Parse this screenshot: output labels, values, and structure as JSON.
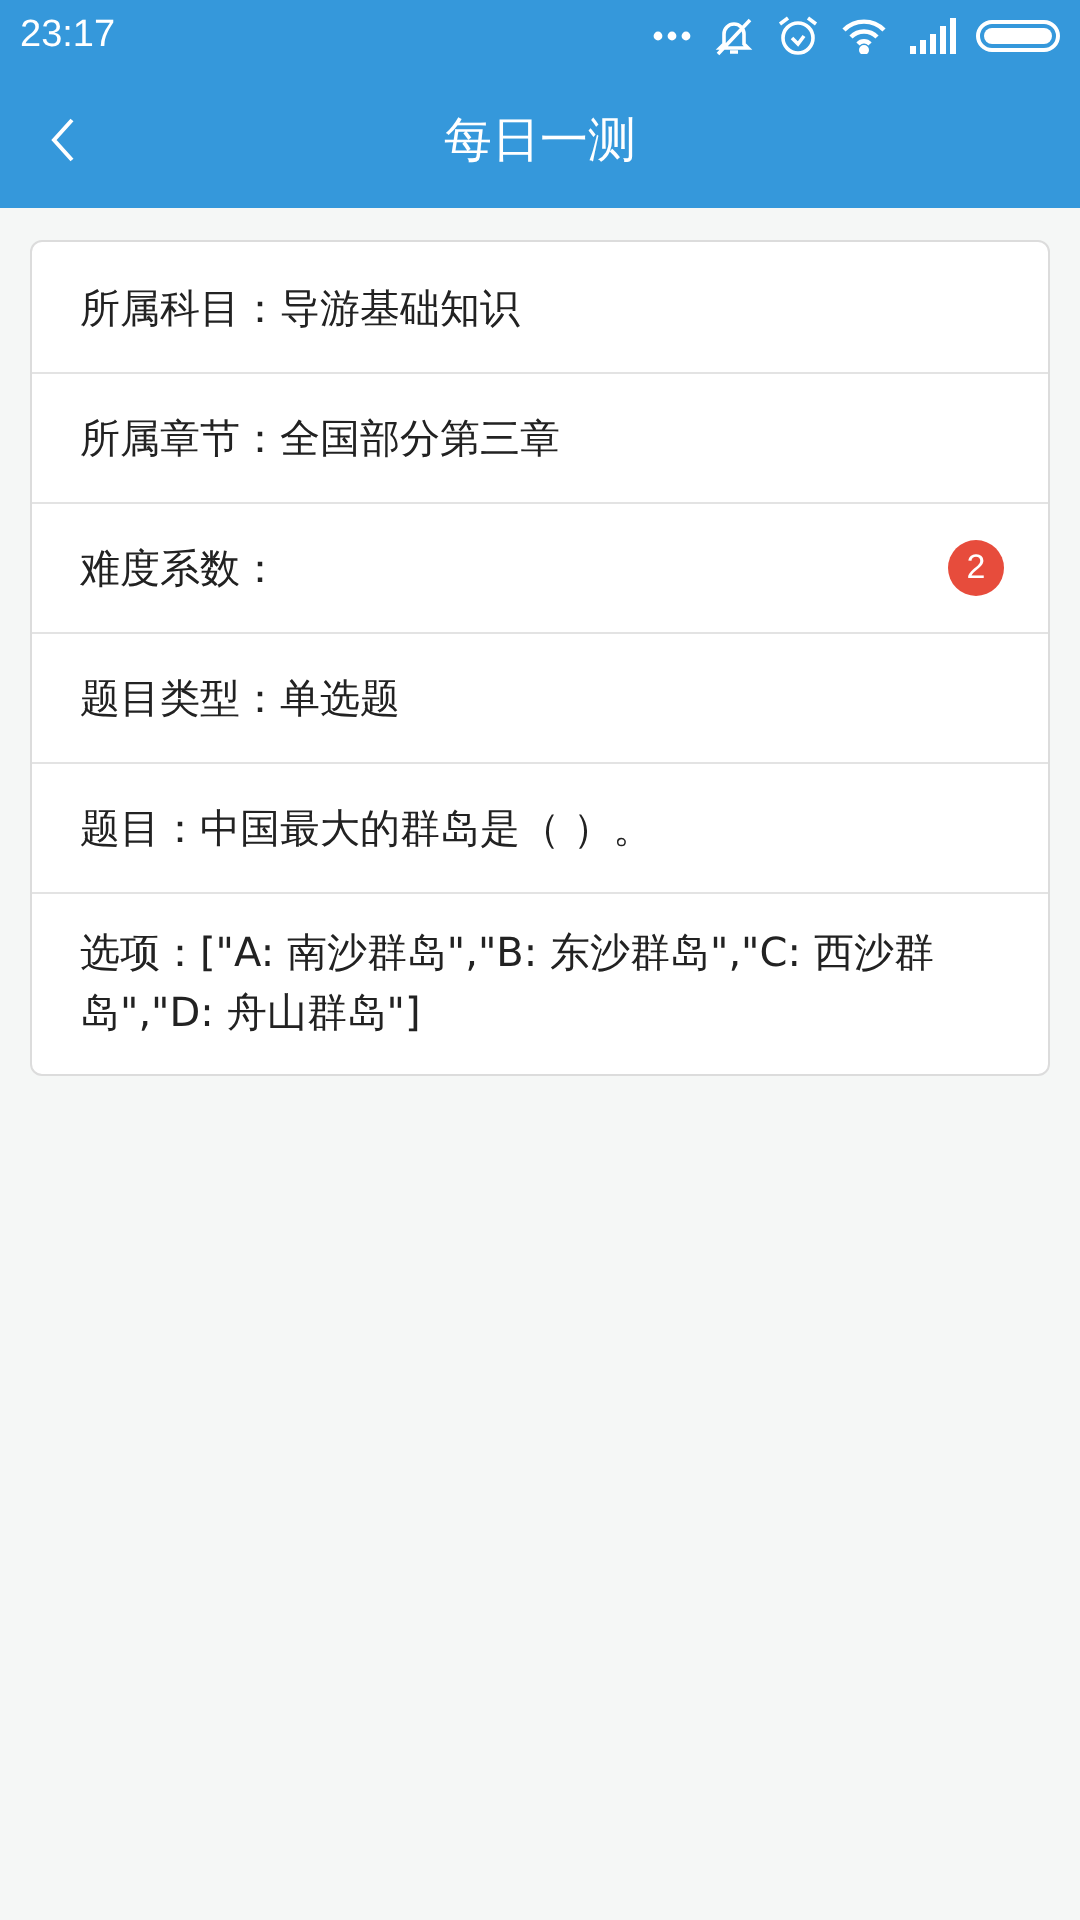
{
  "status_bar": {
    "time": "23:17"
  },
  "header": {
    "title": "每日一测"
  },
  "rows": [
    {
      "kind": "text",
      "text": "所属科目：导游基础知识"
    },
    {
      "kind": "text",
      "text": "所属章节：全国部分第三章"
    },
    {
      "kind": "badge",
      "text": "难度系数：",
      "badge": "2"
    },
    {
      "kind": "text",
      "text": "题目类型：单选题"
    },
    {
      "kind": "text",
      "text": "题目：中国最大的群岛是（  ）。"
    },
    {
      "kind": "text",
      "text": "选项：[\"A: 南沙群岛\",\"B: 东沙群岛\",\"C: 西沙群岛\",\"D: 舟山群岛\"]"
    }
  ]
}
